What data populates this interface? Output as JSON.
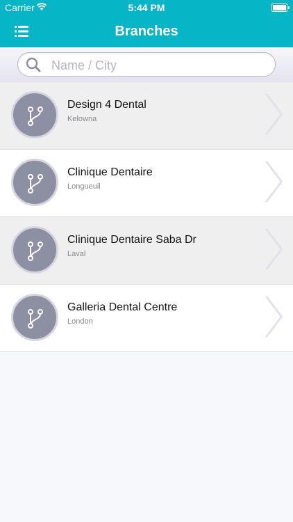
{
  "status_bar": {
    "carrier": "Carrier",
    "time": "5:44 PM"
  },
  "nav": {
    "title": "Branches",
    "menu_icon": "list-menu-icon"
  },
  "search": {
    "placeholder": "Name / City",
    "value": ""
  },
  "branches": [
    {
      "name": "Design 4 Dental",
      "city": "Kelowna"
    },
    {
      "name": "Clinique Dentaire",
      "city": "Longueuil"
    },
    {
      "name": "Clinique Dentaire Saba Dr",
      "city": "Laval"
    },
    {
      "name": "Galleria Dental Centre",
      "city": "London"
    }
  ],
  "colors": {
    "accent": "#06b6c7",
    "avatar": "#8d8fa2",
    "row_shaded": "#efefef"
  }
}
